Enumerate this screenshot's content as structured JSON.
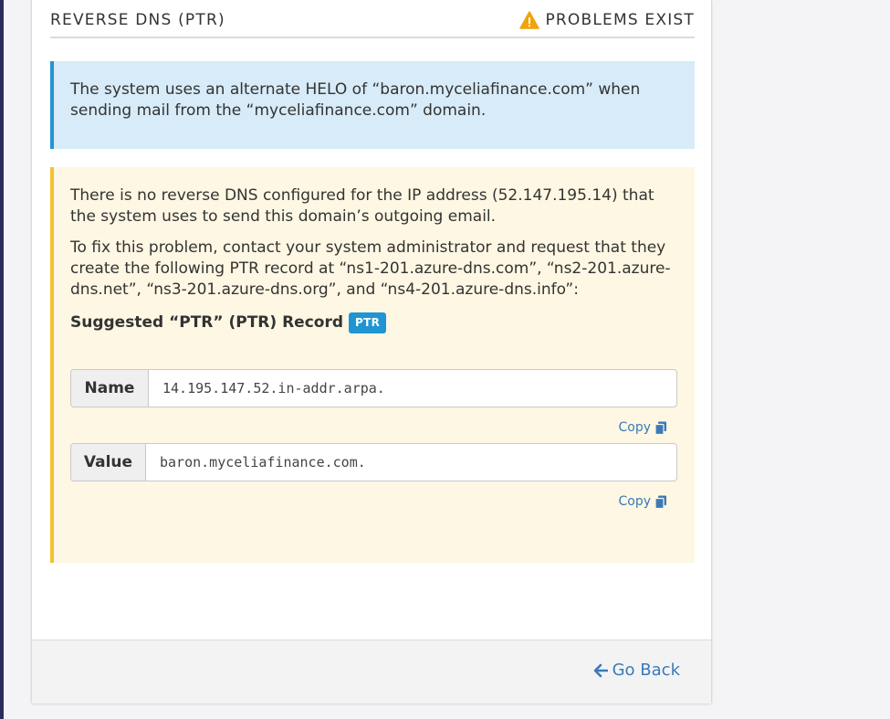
{
  "section": {
    "title": "REVERSE DNS (PTR)",
    "status_icon": "warning-triangle-icon",
    "status_label": "PROBLEMS EXIST"
  },
  "info_alert": {
    "text": "The system uses an alternate HELO of “baron.myceliafinance.com” when sending mail from the “myceliafinance.com” domain."
  },
  "warning_alert": {
    "problem_text": "There is no reverse DNS configured for the IP address (52.147.195.14) that the system uses to send this domain’s outgoing email.",
    "fix_text": "To fix this problem, contact your system administrator and request that they create the following PTR record at “ns1-201.azure-dns.com”, “ns2-201.azure-dns.net”, “ns3-201.azure-dns.org”, and “ns4-201.azure-dns.info”:",
    "suggested_label": "Suggested “PTR” (PTR) Record",
    "badge": "PTR"
  },
  "record": {
    "name_label": "Name",
    "name_value": "14.195.147.52.in-addr.arpa.",
    "value_label": "Value",
    "value_value": "baron.myceliafinance.com.",
    "copy_label": "Copy",
    "copy_icon": "copy-icon"
  },
  "footer": {
    "back_label": "Go Back",
    "back_icon": "arrow-left-icon"
  },
  "colors": {
    "info_bg": "#d7ebf8",
    "info_border": "#2793d2",
    "warn_bg": "#fdf7e3",
    "warn_border": "#f2c230",
    "warning_icon": "#f0a30a",
    "badge_bg": "#1f95d3",
    "link": "#3a7ab8"
  }
}
